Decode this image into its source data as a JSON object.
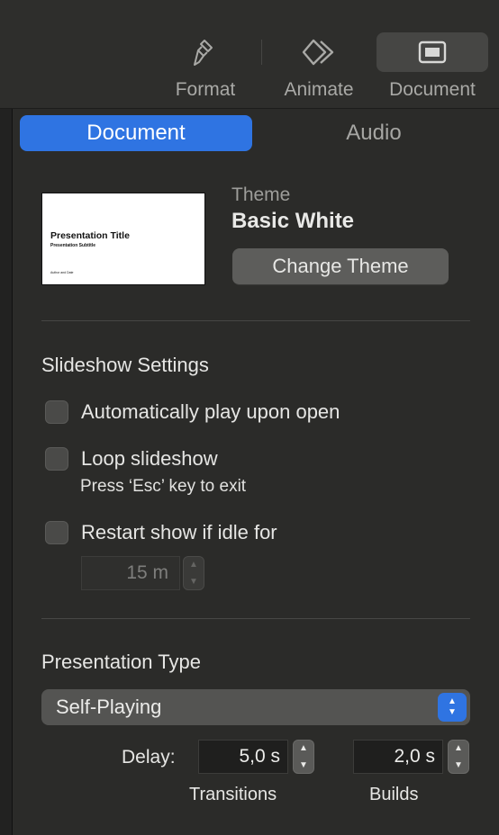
{
  "toolbar": {
    "items": [
      {
        "label": "Format",
        "icon": "paintbrush-icon"
      },
      {
        "label": "Animate",
        "icon": "diamond-icon"
      },
      {
        "label": "Document",
        "icon": "document-icon",
        "selected": true
      }
    ]
  },
  "tabs": [
    {
      "label": "Document",
      "active": true
    },
    {
      "label": "Audio",
      "active": false
    }
  ],
  "theme": {
    "caption": "Theme",
    "name": "Basic White",
    "change_button": "Change Theme",
    "thumbnail": {
      "title": "Presentation Title",
      "subtitle": "Presentation Subtitle",
      "author": "Author and Date"
    }
  },
  "slideshow": {
    "title": "Slideshow Settings",
    "auto_play": {
      "label": "Automatically play upon open",
      "checked": false
    },
    "loop": {
      "label": "Loop slideshow",
      "checked": false,
      "hint": "Press ‘Esc’ key to exit"
    },
    "restart": {
      "label": "Restart show if idle for",
      "checked": false,
      "value": "15 m"
    }
  },
  "presentation": {
    "title": "Presentation Type",
    "selected": "Self-Playing",
    "delay_label": "Delay:",
    "transitions_value": "5,0 s",
    "transitions_label": "Transitions",
    "builds_value": "2,0 s",
    "builds_label": "Builds"
  },
  "colors": {
    "accent": "#2f74e2",
    "background": "#2b2b29"
  }
}
